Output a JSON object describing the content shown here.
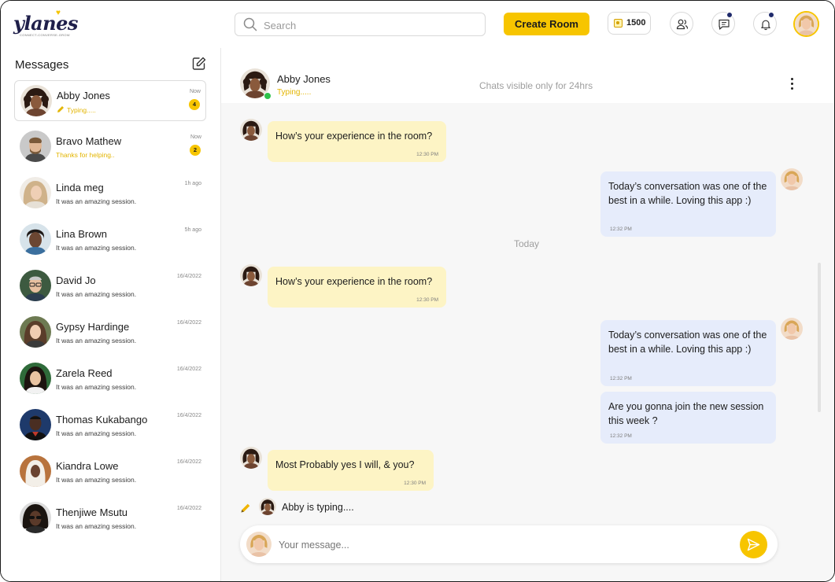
{
  "brand": {
    "name": "ylanes",
    "tagline": "CONNECT-CONVERSE-GROW"
  },
  "search": {
    "placeholder": "Search"
  },
  "header": {
    "create_room_label": "Create Room",
    "coins": "1500"
  },
  "colors": {
    "accent": "#F7C500",
    "incoming_bubble": "#FDF4C5",
    "outgoing_bubble": "#E6ECFB",
    "online": "#2EC24B"
  },
  "sidebar": {
    "title": "Messages",
    "conversations": [
      {
        "name": "Abby Jones",
        "preview": "Typing.....",
        "time": "Now",
        "badge": "4"
      },
      {
        "name": "Bravo Mathew",
        "preview": "Thanks for helping..",
        "time": "Now",
        "badge": "2"
      },
      {
        "name": "Linda meg",
        "preview": "It was an amazing session.",
        "time": "1h ago"
      },
      {
        "name": "Lina Brown",
        "preview": "It was an amazing session.",
        "time": "5h ago"
      },
      {
        "name": "David Jo",
        "preview": "It was an amazing session.",
        "time": "16/4/2022"
      },
      {
        "name": "Gypsy Hardinge",
        "preview": "It was an amazing session.",
        "time": "16/4/2022"
      },
      {
        "name": "Zarela Reed",
        "preview": "It was an amazing session.",
        "time": "16/4/2022"
      },
      {
        "name": "Thomas Kukabango",
        "preview": "It was an amazing session.",
        "time": "16/4/2022"
      },
      {
        "name": "Kiandra Lowe",
        "preview": "It was an amazing session.",
        "time": "16/4/2022"
      },
      {
        "name": "Thenjiwe Msutu",
        "preview": "It was an amazing session.",
        "time": "16/4/2022"
      }
    ]
  },
  "chat": {
    "contact_name": "Abby Jones",
    "contact_status": "Typing.....",
    "note": "Chats visible only for 24hrs",
    "day_separator": "Today",
    "messages": [
      {
        "text": "How’s your experience in the room?",
        "time": "12:30 PM"
      },
      {
        "text": "Today’s conversation was one of the best in a while. Loving this app :)",
        "time": "12:32 PM"
      },
      {
        "text": "How’s your experience in the room?",
        "time": "12:30 PM"
      },
      {
        "text": "Today’s conversation was one of the best in a while. Loving this app :)",
        "time": "12:32 PM"
      },
      {
        "text": "Are you gonna join the new session this week ?",
        "time": "12:32 PM"
      },
      {
        "text": "Most Probably yes I will, & you?",
        "time": "12:30 PM"
      }
    ],
    "typing_text": "Abby is typing....",
    "composer_placeholder": "Your message..."
  }
}
